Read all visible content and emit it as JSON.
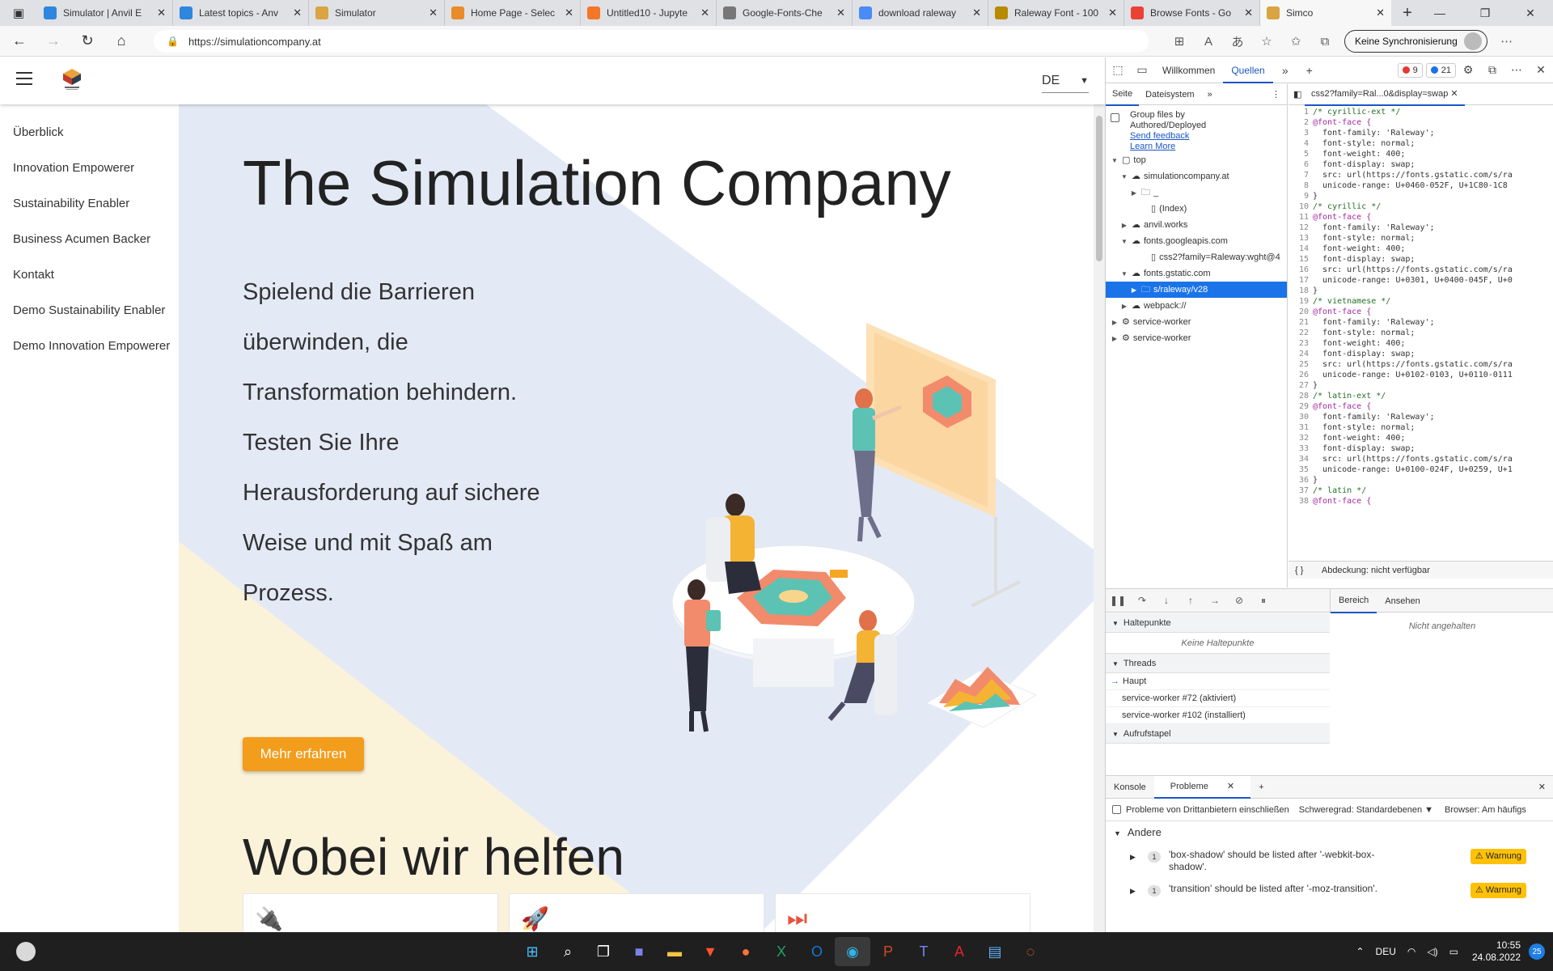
{
  "browser": {
    "tabs": [
      {
        "title": "Simulator | Anvil E",
        "color": "#2e86de"
      },
      {
        "title": "Latest topics - Anv",
        "color": "#2e86de"
      },
      {
        "title": "Simulator",
        "color": "#d9a441"
      },
      {
        "title": "Home Page - Selec",
        "color": "#e98b2a"
      },
      {
        "title": "Untitled10 - Jupyte",
        "color": "#f37726"
      },
      {
        "title": "Google-Fonts-Che",
        "color": "#777777"
      },
      {
        "title": "download raleway",
        "color": "#4a8bf5"
      },
      {
        "title": "Raleway Font - 100",
        "color": "#b88a00"
      },
      {
        "title": "Browse Fonts - Go",
        "color": "#ea4335"
      }
    ],
    "active_tab": "Simco",
    "url": "https://simulationcompany.at",
    "sync_label": "Keine Synchronisierung"
  },
  "site": {
    "lang": "DE",
    "nav": [
      "Überblick",
      "Innovation Empowerer",
      "Sustainability Enabler",
      "Business Acumen Backer",
      "Kontakt",
      "Demo Sustainability Enabler",
      "Demo Innovation Empowerer"
    ],
    "title": "The Simulation Company",
    "lead_lines": [
      "Spielend die Barrieren",
      "überwinden, die",
      "Transformation behindern.",
      "Testen Sie Ihre",
      "Herausforderung auf sichere",
      "Weise und mit Spaß am",
      "Prozess."
    ],
    "cta": "Mehr erfahren",
    "section_title": "Wobei wir helfen",
    "card_icons": [
      "plug-icon",
      "rocket-icon",
      "fast-forward-icon"
    ]
  },
  "devtools": {
    "tabs": [
      "Willkommen",
      "Quellen"
    ],
    "errors": "9",
    "infos": "21",
    "left_tabs": [
      "Seite",
      "Dateisystem"
    ],
    "group_label_1": "Group files by",
    "group_label_2": "Authored/Deployed",
    "send_feedback": "Send feedback",
    "learn_more": "Learn More",
    "tree": [
      {
        "label": "top",
        "indent": 0,
        "tw": "▼",
        "icon": "frame"
      },
      {
        "label": "simulationcompany.at",
        "indent": 1,
        "tw": "▼",
        "icon": "cloud"
      },
      {
        "label": "_",
        "indent": 2,
        "tw": "▶",
        "icon": "folder"
      },
      {
        "label": "(Index)",
        "indent": 3,
        "tw": "",
        "icon": "file"
      },
      {
        "label": "anvil.works",
        "indent": 1,
        "tw": "▶",
        "icon": "cloud"
      },
      {
        "label": "fonts.googleapis.com",
        "indent": 1,
        "tw": "▼",
        "icon": "cloud"
      },
      {
        "label": "css2?family=Raleway:wght@4",
        "indent": 3,
        "tw": "",
        "icon": "file"
      },
      {
        "label": "fonts.gstatic.com",
        "indent": 1,
        "tw": "▼",
        "icon": "cloud"
      },
      {
        "label": "s/raleway/v28",
        "indent": 2,
        "tw": "▶",
        "icon": "folder",
        "selected": true
      },
      {
        "label": "webpack://",
        "indent": 1,
        "tw": "▶",
        "icon": "cloud"
      },
      {
        "label": "service-worker",
        "indent": 0,
        "tw": "▶",
        "icon": "gear"
      },
      {
        "label": "service-worker",
        "indent": 0,
        "tw": "▶",
        "icon": "gear"
      }
    ],
    "code_tab": "css2?family=Ral...0&display=swap",
    "code": [
      [
        "1",
        "/* cyrillic-ext */",
        "cm"
      ],
      [
        "2",
        "@font-face {",
        "kw"
      ],
      [
        "3",
        "  font-family: 'Raleway';",
        "p"
      ],
      [
        "4",
        "  font-style: normal;",
        "p"
      ],
      [
        "5",
        "  font-weight: 400;",
        "p"
      ],
      [
        "6",
        "  font-display: swap;",
        "p"
      ],
      [
        "7",
        "  src: url(https://fonts.gstatic.com/s/ra",
        "p"
      ],
      [
        "8",
        "  unicode-range: U+0460-052F, U+1C80-1C8",
        "p"
      ],
      [
        "9",
        "}",
        "p"
      ],
      [
        "10",
        "/* cyrillic */",
        "cm"
      ],
      [
        "11",
        "@font-face {",
        "kw"
      ],
      [
        "12",
        "  font-family: 'Raleway';",
        "p"
      ],
      [
        "13",
        "  font-style: normal;",
        "p"
      ],
      [
        "14",
        "  font-weight: 400;",
        "p"
      ],
      [
        "15",
        "  font-display: swap;",
        "p"
      ],
      [
        "16",
        "  src: url(https://fonts.gstatic.com/s/ra",
        "p"
      ],
      [
        "17",
        "  unicode-range: U+0301, U+0400-045F, U+0",
        "p"
      ],
      [
        "18",
        "}",
        "p"
      ],
      [
        "19",
        "/* vietnamese */",
        "cm"
      ],
      [
        "20",
        "@font-face {",
        "kw"
      ],
      [
        "21",
        "  font-family: 'Raleway';",
        "p"
      ],
      [
        "22",
        "  font-style: normal;",
        "p"
      ],
      [
        "23",
        "  font-weight: 400;",
        "p"
      ],
      [
        "24",
        "  font-display: swap;",
        "p"
      ],
      [
        "25",
        "  src: url(https://fonts.gstatic.com/s/ra",
        "p"
      ],
      [
        "26",
        "  unicode-range: U+0102-0103, U+0110-0111",
        "p"
      ],
      [
        "27",
        "}",
        "p"
      ],
      [
        "28",
        "/* latin-ext */",
        "cm"
      ],
      [
        "29",
        "@font-face {",
        "kw"
      ],
      [
        "30",
        "  font-family: 'Raleway';",
        "p"
      ],
      [
        "31",
        "  font-style: normal;",
        "p"
      ],
      [
        "32",
        "  font-weight: 400;",
        "p"
      ],
      [
        "33",
        "  font-display: swap;",
        "p"
      ],
      [
        "34",
        "  src: url(https://fonts.gstatic.com/s/ra",
        "p"
      ],
      [
        "35",
        "  unicode-range: U+0100-024F, U+0259, U+1",
        "p"
      ],
      [
        "36",
        "}",
        "p"
      ],
      [
        "37",
        "/* latin */",
        "cm"
      ],
      [
        "38",
        "@font-face {",
        "kw"
      ]
    ],
    "coverage": "Abdeckung: nicht verfügbar",
    "right_tabs": [
      "Bereich",
      "Ansehen"
    ],
    "not_paused": "Nicht angehalten",
    "breakpoints_title": "Haltepunkte",
    "no_breakpoints": "Keine Haltepunkte",
    "threads_title": "Threads",
    "threads": [
      "Haupt",
      "service-worker #72 (aktiviert)",
      "service-worker #102 (installiert)"
    ],
    "callstack_title": "Aufrufstapel",
    "drawer_tabs": [
      "Konsole",
      "Probleme"
    ],
    "third_party": "Probleme von Drittanbietern einschließen",
    "severity": "Schweregrad: Standardebenen",
    "browser_filter": "Browser: Am häufigs",
    "category": "Andere",
    "issues": [
      {
        "count": "1",
        "line1": "'box-shadow' should be listed after '-webkit-box-",
        "line2": "shadow'.",
        "level": "Warnung"
      },
      {
        "count": "1",
        "line1": "'transition' should be listed after '-moz-transition'.",
        "line2": "",
        "level": "Warnung"
      }
    ]
  },
  "taskbar": {
    "lang": "DEU",
    "time": "10:55",
    "date": "24.08.2022",
    "notifications": "25"
  }
}
